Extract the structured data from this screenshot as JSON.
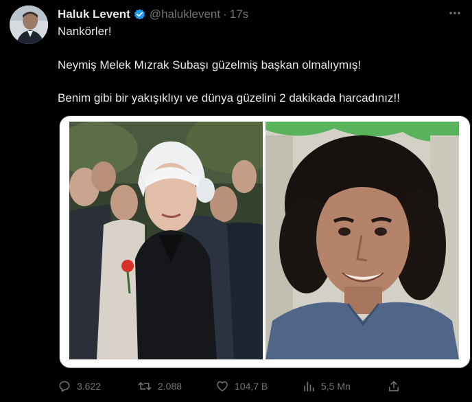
{
  "author": {
    "name": "Haluk Levent",
    "handle": "@haluklevent",
    "separator": "·",
    "time": "17s",
    "verified": true
  },
  "tweet": {
    "lines": [
      "Nankörler!",
      "Neymiş Melek Mızrak Subaşı güzelmiş başkan olmalıymış!",
      "Benim gibi bir yakışıklıyı ve dünya güzelini 2 dakikada harcadınız!!"
    ]
  },
  "media": {
    "images": [
      "photo-woman-white-hair",
      "photo-man-curly-hair"
    ]
  },
  "actions": {
    "replies": "3.622",
    "reposts": "2.088",
    "likes": "104,7 B",
    "views": "5,5 Mn"
  },
  "icons": {
    "more": "more-horizontal-icon",
    "reply": "reply-icon",
    "repost": "repost-icon",
    "like": "heart-icon",
    "views": "views-chart-icon",
    "share": "share-icon",
    "verified": "verified-badge-icon"
  },
  "colors": {
    "background": "#000000",
    "text": "#e7e9ea",
    "muted": "#71767b",
    "verified": "#1d9bf0",
    "border": "#2f3336"
  }
}
